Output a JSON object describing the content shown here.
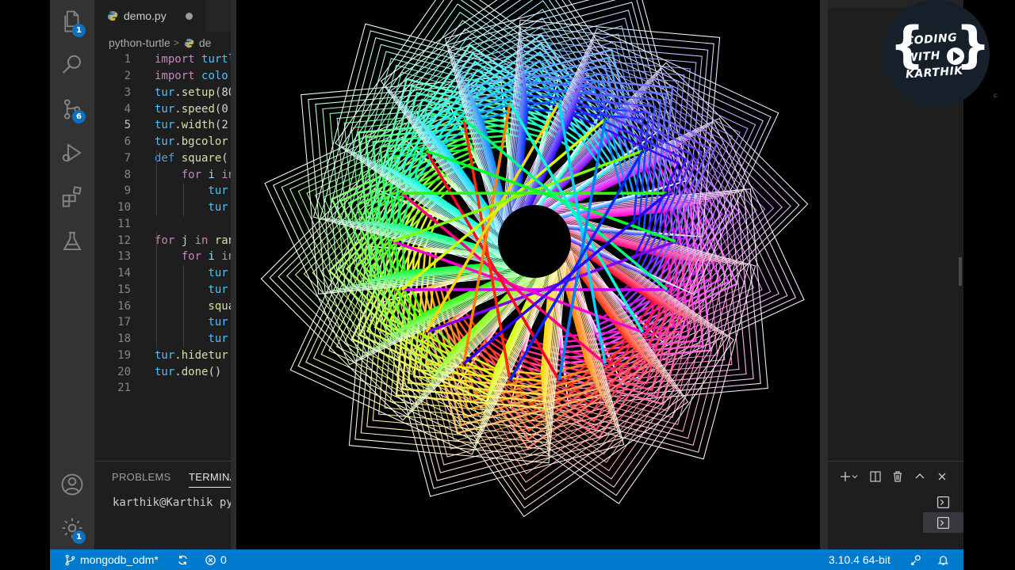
{
  "editor": {
    "tab_label": "demo.py",
    "breadcrumb": [
      "python-turtle",
      "de"
    ],
    "lines": [
      {
        "n": "1",
        "parts": [
          [
            "kw",
            "import "
          ],
          [
            "id",
            "turtl"
          ]
        ]
      },
      {
        "n": "2",
        "parts": [
          [
            "kw",
            "import "
          ],
          [
            "id",
            "colo"
          ]
        ]
      },
      {
        "n": "3",
        "parts": [
          [
            "id",
            "tur"
          ],
          [
            "tx",
            "."
          ],
          [
            "fn",
            "setup"
          ],
          [
            "tx",
            "(80"
          ]
        ]
      },
      {
        "n": "4",
        "parts": [
          [
            "id",
            "tur"
          ],
          [
            "tx",
            "."
          ],
          [
            "fn",
            "speed"
          ],
          [
            "tx",
            "(0"
          ]
        ]
      },
      {
        "n": "5",
        "parts": [
          [
            "id",
            "tur"
          ],
          [
            "tx",
            "."
          ],
          [
            "fn",
            "width"
          ],
          [
            "tx",
            "(2"
          ]
        ]
      },
      {
        "n": "6",
        "parts": [
          [
            "id",
            "tur"
          ],
          [
            "tx",
            "."
          ],
          [
            "fn",
            "bgcolor"
          ]
        ]
      },
      {
        "n": "7",
        "parts": [
          [
            "kw2",
            "def "
          ],
          [
            "fn",
            "square"
          ],
          [
            "tx",
            "("
          ]
        ]
      },
      {
        "n": "8",
        "parts": [
          [
            "kw",
            "    for "
          ],
          [
            "vr",
            "i "
          ],
          [
            "kw",
            "in"
          ]
        ]
      },
      {
        "n": "9",
        "parts": [
          [
            "id",
            "        tur"
          ]
        ]
      },
      {
        "n": "10",
        "parts": [
          [
            "id",
            "        tur"
          ]
        ]
      },
      {
        "n": "11",
        "parts": []
      },
      {
        "n": "12",
        "parts": [
          [
            "kw",
            "for "
          ],
          [
            "vr",
            "j "
          ],
          [
            "kw",
            "in "
          ],
          [
            "fn",
            "ran"
          ]
        ]
      },
      {
        "n": "13",
        "parts": [
          [
            "kw",
            "    for "
          ],
          [
            "vr",
            "i "
          ],
          [
            "kw",
            "in"
          ]
        ]
      },
      {
        "n": "14",
        "parts": [
          [
            "id",
            "        tur"
          ]
        ]
      },
      {
        "n": "15",
        "parts": [
          [
            "id",
            "        tur"
          ]
        ]
      },
      {
        "n": "16",
        "parts": [
          [
            "fn",
            "        squa"
          ]
        ]
      },
      {
        "n": "17",
        "parts": [
          [
            "id",
            "        tur"
          ]
        ]
      },
      {
        "n": "18",
        "parts": [
          [
            "id",
            "        tur"
          ]
        ]
      },
      {
        "n": "19",
        "parts": [
          [
            "id",
            "tur"
          ],
          [
            "tx",
            "."
          ],
          [
            "fn",
            "hidetur"
          ]
        ]
      },
      {
        "n": "20",
        "parts": [
          [
            "id",
            "tur"
          ],
          [
            "tx",
            "."
          ],
          [
            "fn",
            "done"
          ],
          [
            "tx",
            "()"
          ]
        ]
      },
      {
        "n": "21",
        "parts": []
      }
    ],
    "active_line": "5"
  },
  "activity_bar": {
    "explorer_badge": "1",
    "source_control_badge": "6",
    "settings_badge": "1"
  },
  "panel": {
    "tabs": [
      "PROBLEMS",
      "TERMINA"
    ],
    "terminal_prompt": "karthik@Karthik py"
  },
  "status_bar": {
    "branch": "mongodb_odm*",
    "errors": "0",
    "interpreter": "3.10.4 64-bit"
  },
  "logo": {
    "line1": "CODING",
    "line2": "WITH",
    "line3": "KARTHIK"
  },
  "colors": {
    "activity_bar": "#333333",
    "editor_bg": "#1e1e1e",
    "status_bar": "#007acc",
    "badge": "#0e70c0"
  }
}
